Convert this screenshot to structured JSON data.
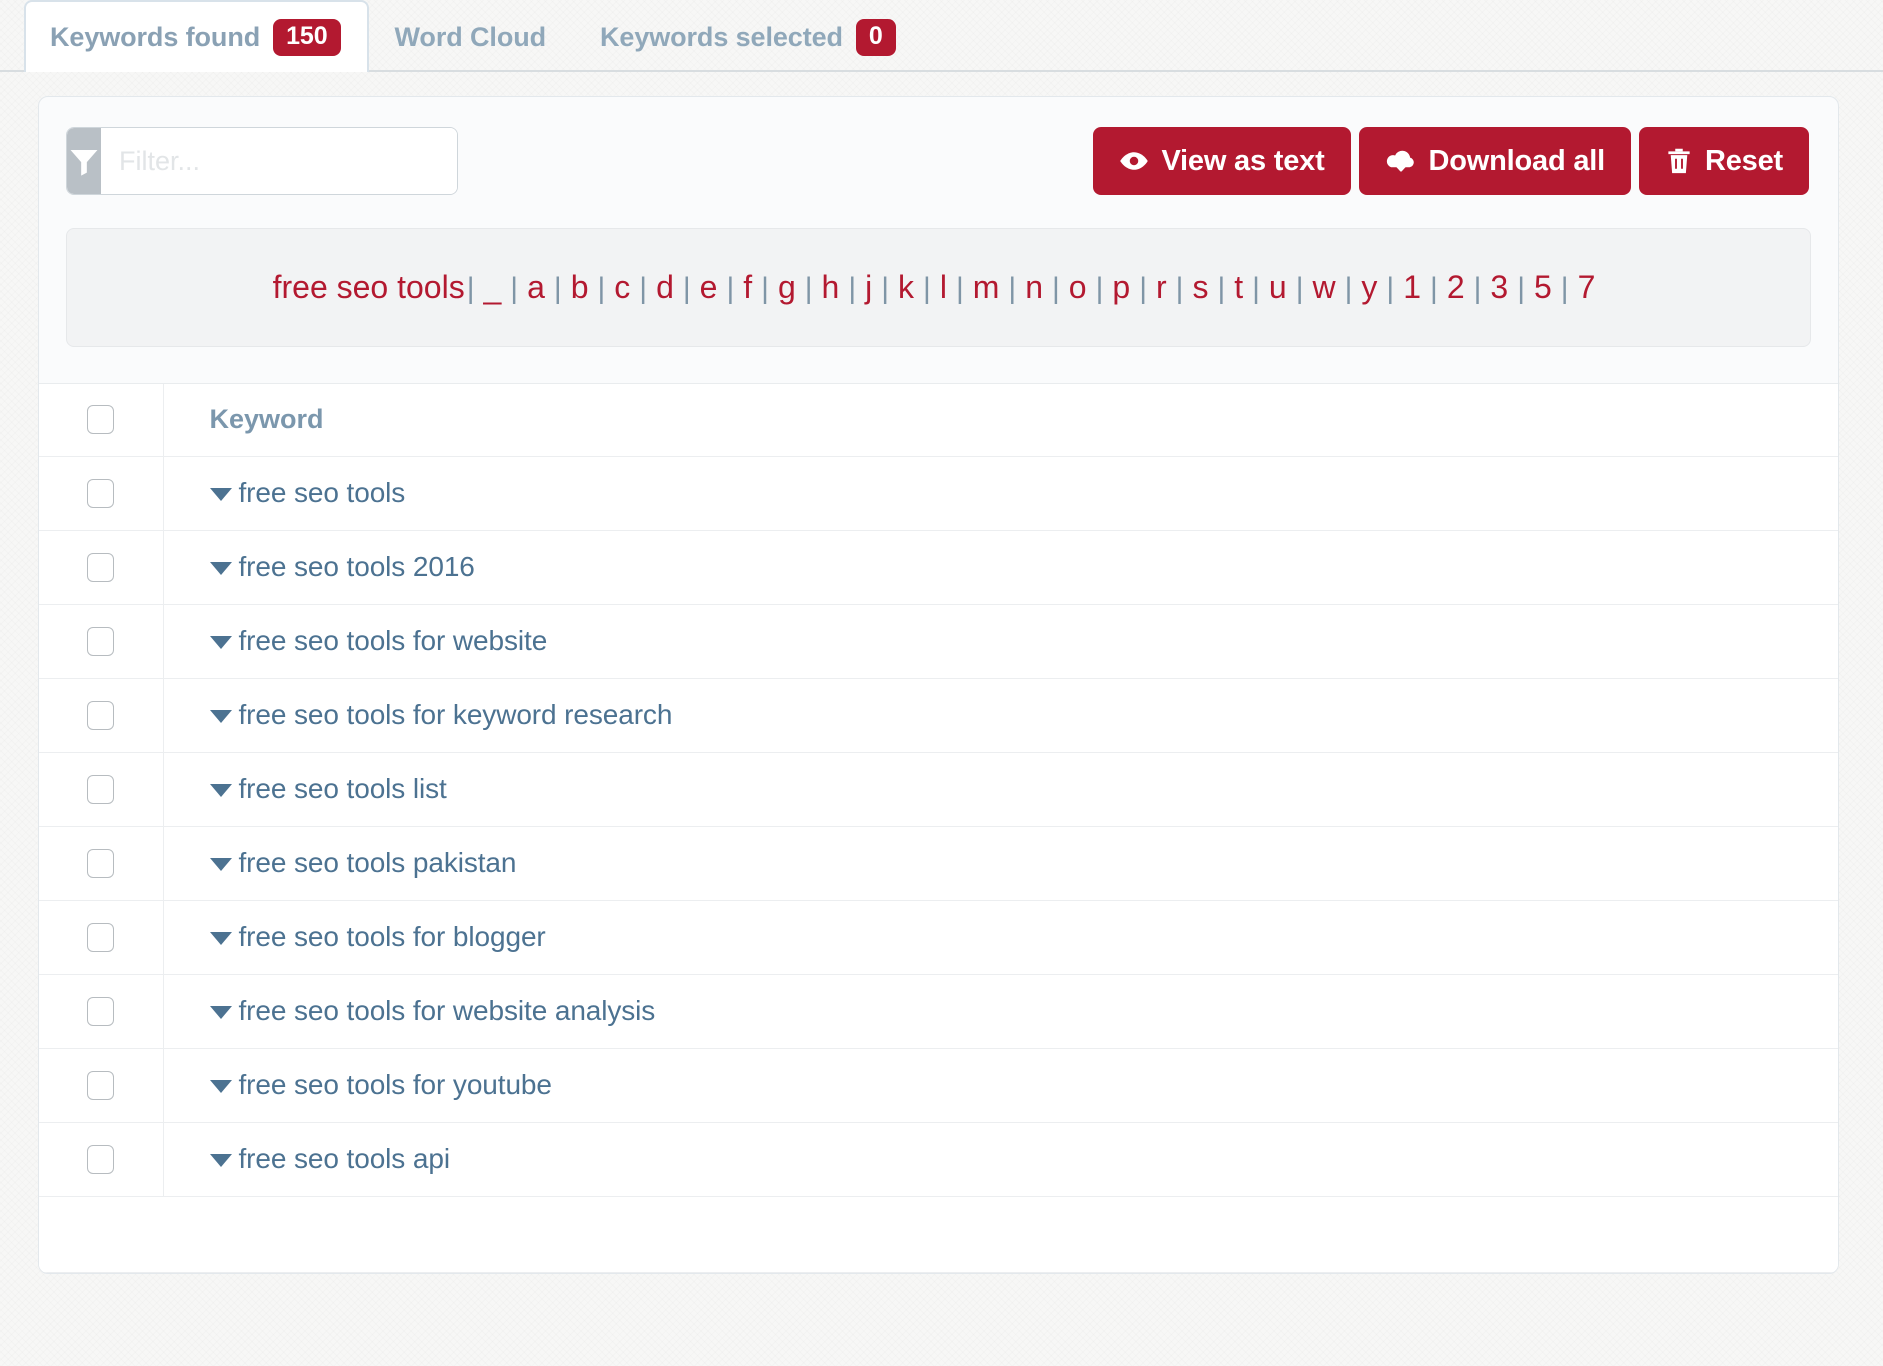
{
  "colors": {
    "brand_red": "#b31930",
    "tab_text": "#90a8ba",
    "keyword_text": "#4c7291",
    "header_text": "#7b97ad"
  },
  "tabs": [
    {
      "label": "Keywords found",
      "badge": "150",
      "active": true
    },
    {
      "label": "Word Cloud",
      "badge": null,
      "active": false
    },
    {
      "label": "Keywords selected",
      "badge": "0",
      "active": false
    }
  ],
  "toolbar": {
    "filter": {
      "icon": "filter-funnel-icon",
      "value": "",
      "placeholder": "Filter..."
    },
    "buttons": [
      {
        "label": "View as text",
        "icon": "eye-icon"
      },
      {
        "label": "Download all",
        "icon": "cloud-download-icon"
      },
      {
        "label": "Reset",
        "icon": "trash-icon"
      }
    ]
  },
  "alphabet_bar": {
    "term": "free seo tools",
    "separator": "|",
    "links": [
      "_",
      "a",
      "b",
      "c",
      "d",
      "e",
      "f",
      "g",
      "h",
      "j",
      "k",
      "l",
      "m",
      "n",
      "o",
      "p",
      "r",
      "s",
      "t",
      "u",
      "w",
      "y",
      "1",
      "2",
      "3",
      "5",
      "7"
    ]
  },
  "table": {
    "columns": [
      "",
      "Keyword"
    ],
    "header_keyword": "Keyword",
    "rows": [
      {
        "keyword": "free seo tools",
        "checked": false
      },
      {
        "keyword": "free seo tools 2016",
        "checked": false
      },
      {
        "keyword": "free seo tools for website",
        "checked": false
      },
      {
        "keyword": "free seo tools for keyword research",
        "checked": false
      },
      {
        "keyword": "free seo tools list",
        "checked": false
      },
      {
        "keyword": "free seo tools pakistan",
        "checked": false
      },
      {
        "keyword": "free seo tools for blogger",
        "checked": false
      },
      {
        "keyword": "free seo tools for website analysis",
        "checked": false
      },
      {
        "keyword": "free seo tools for youtube",
        "checked": false
      },
      {
        "keyword": "free seo tools api",
        "checked": false
      }
    ]
  }
}
